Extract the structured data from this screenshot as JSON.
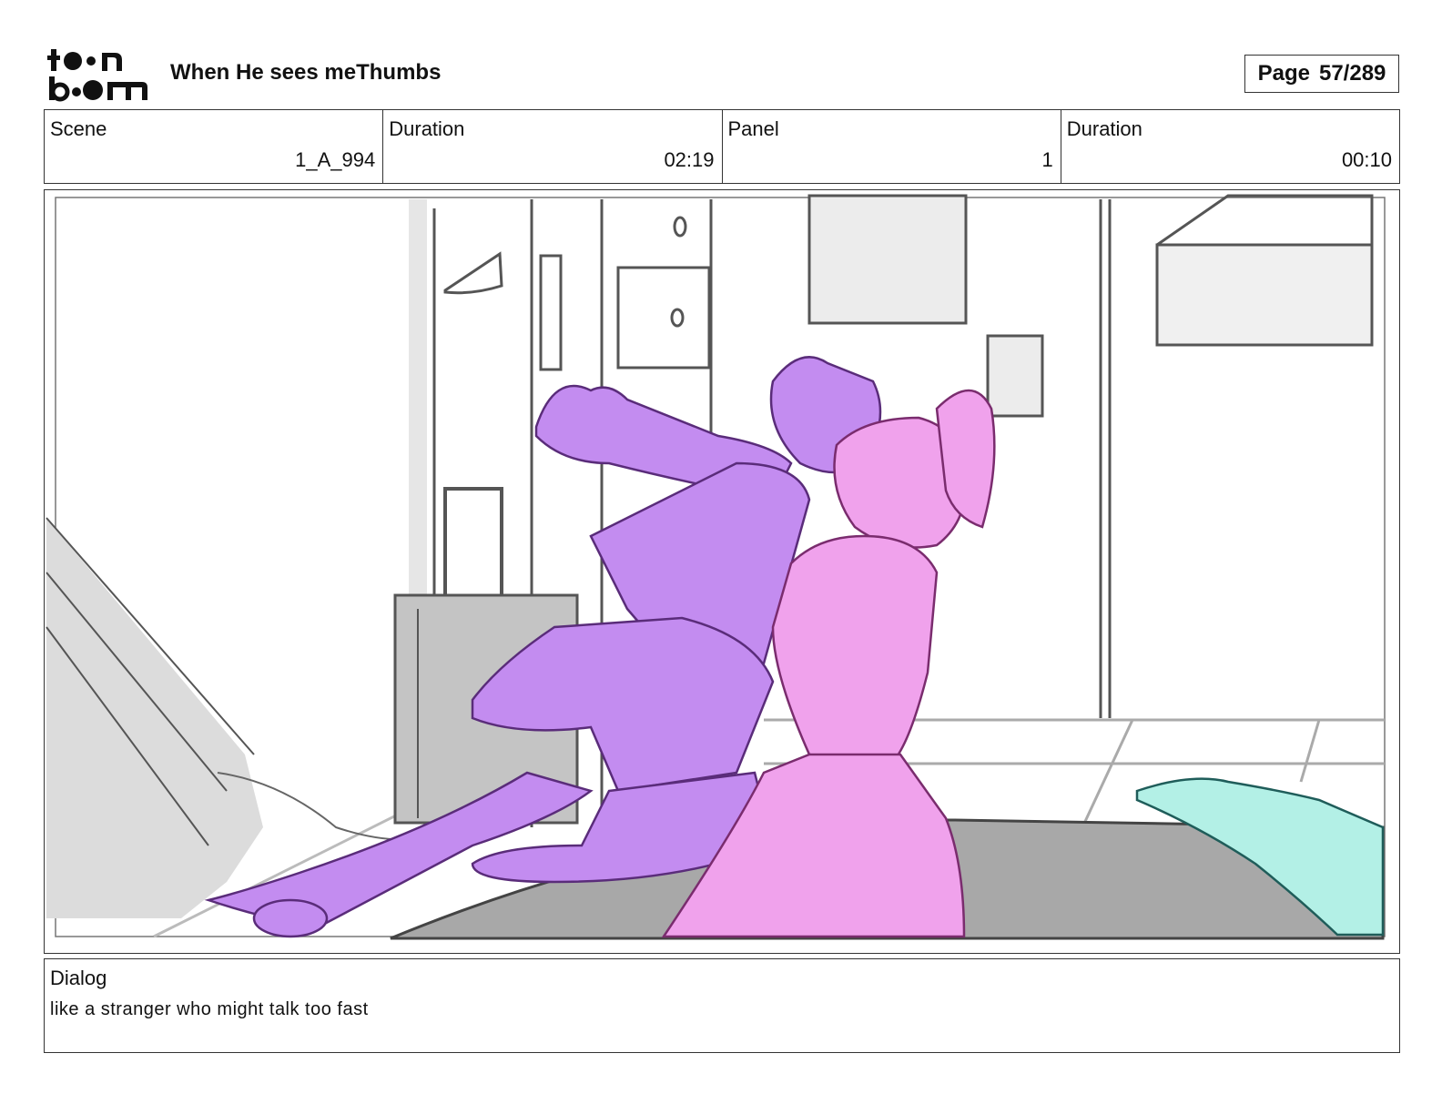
{
  "header": {
    "logo_text": "toon boom",
    "project_title": "When He sees meThumbs",
    "page_label": "Page",
    "page_number": "57/289"
  },
  "info": {
    "scene_label": "Scene",
    "scene_value": "1_A_994",
    "scene_duration_label": "Duration",
    "scene_duration_value": "02:19",
    "panel_label": "Panel",
    "panel_value": "1",
    "panel_duration_label": "Duration",
    "panel_duration_value": "00:10"
  },
  "dialog": {
    "label": "Dialog",
    "text": "like a stranger who might talk too fast"
  },
  "colors": {
    "purple_character": "#c38cf0",
    "pink_character": "#f0a2ec",
    "teal_character": "#b3f0e6",
    "background_sketch": "#d9d9d9",
    "line_dark": "#3a3a3a"
  }
}
